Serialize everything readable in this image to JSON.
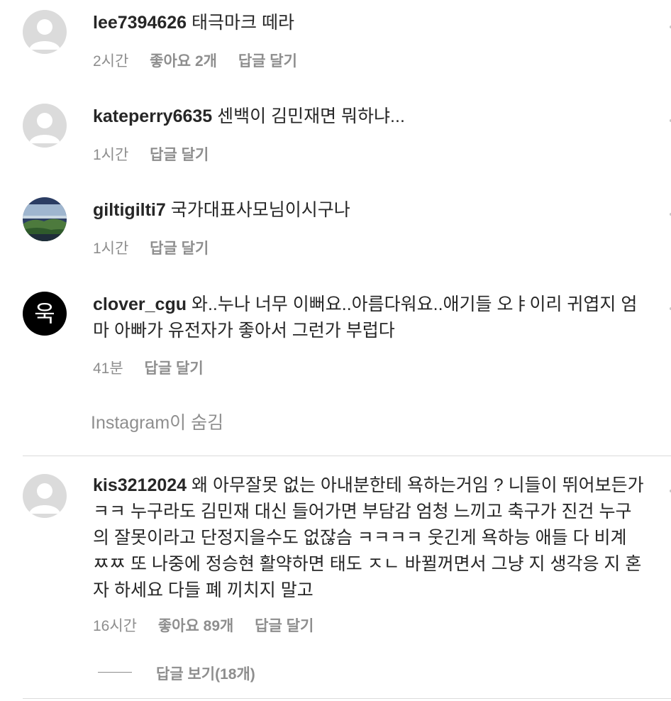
{
  "comments": [
    {
      "username": "lee7394626",
      "text": "태극마크 떼라",
      "time": "2시간",
      "likes": "좋아요 2개",
      "reply": "답글 달기"
    },
    {
      "username": "kateperry6635",
      "text": "센백이 김민재면 뭐하냐...",
      "time": "1시간",
      "reply": "답글 달기"
    },
    {
      "username": "giltigilti7",
      "text": "국가대표사모님이시구나",
      "time": "1시간",
      "reply": "답글 달기"
    },
    {
      "username": "clover_cgu",
      "text": "와..누나 너무 이뻐요..아름다워요..애기들 오ㅑ이리 귀엽지 엄마 아빠가 유전자가 좋아서 그런가 부럽다",
      "time": "41분",
      "reply": "답글 달기",
      "avatar_glyph": "욱"
    },
    {
      "username": "kis3212024",
      "text": "왜 아무잘못 없는 아내분한테 욕하는거임 ? 니들이 뛰어보든가 ㅋㅋ 누구라도 김민재 대신 들어가면 부담감 엄청 느끼고 축구가 진건 누구의 잘못이라고 단정지을수도 없잖슴 ㅋㅋㅋㅋ 웃긴게 욕하능 애들 다 비계 ㅉㅉ 또 나중에 정승현 활약하면 태도 ㅈㄴ 바뀔꺼면서 그냥 지 생각응 지 혼자 하세요 다들 폐 끼치지 말고",
      "time": "16시간",
      "likes": "좋아요 89개",
      "reply": "답글 달기"
    }
  ],
  "hidden_label": "Instagram이 숨김",
  "view_replies": "답글 보기(18개)",
  "colors": {
    "text": "#262626",
    "secondary": "#8e8e8e",
    "divider": "#dbdbdb",
    "avatar_default": "#dbdbdb"
  }
}
